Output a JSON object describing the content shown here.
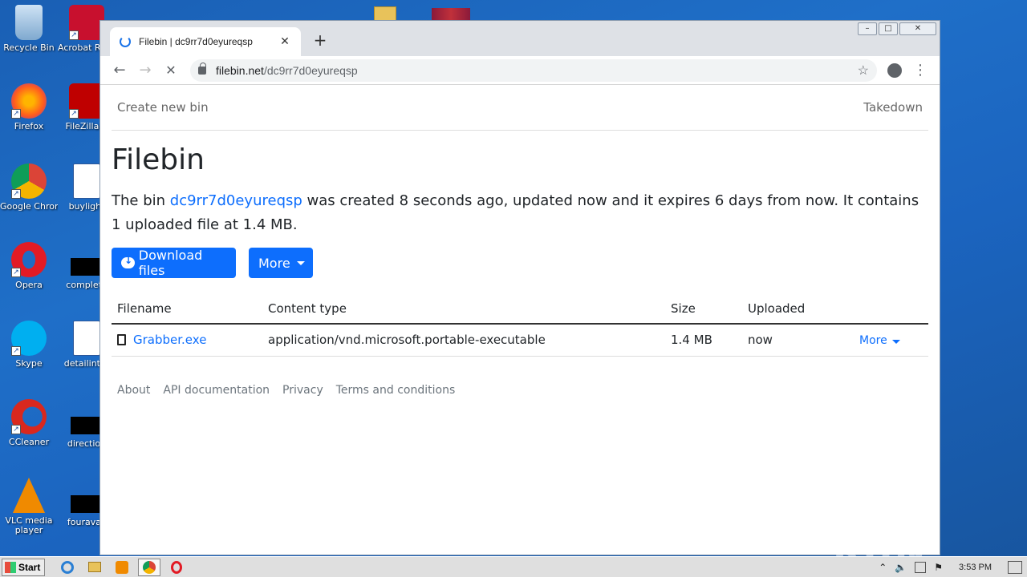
{
  "desktop": {
    "icons": [
      {
        "label": "Recycle Bin",
        "icon": "recycle-bin-icon"
      },
      {
        "label": "Acrobat Reader",
        "icon": "acrobat-icon"
      },
      {
        "label": "Firefox",
        "icon": "firefox-icon"
      },
      {
        "label": "FileZilla C",
        "icon": "filezilla-icon"
      },
      {
        "label": "Google Chrome",
        "icon": "chrome-icon"
      },
      {
        "label": "buylight",
        "icon": "word-doc-icon"
      },
      {
        "label": "Opera",
        "icon": "opera-icon"
      },
      {
        "label": "complete",
        "icon": "file-icon"
      },
      {
        "label": "Skype",
        "icon": "skype-icon"
      },
      {
        "label": "detailinter",
        "icon": "word-doc-icon"
      },
      {
        "label": "CCleaner",
        "icon": "ccleaner-icon"
      },
      {
        "label": "direction",
        "icon": "file-icon"
      },
      {
        "label": "VLC media player",
        "icon": "vlc-icon"
      },
      {
        "label": "fouravail",
        "icon": "file-icon"
      }
    ]
  },
  "browser": {
    "tab_title": "Filebin | dc9rr7d0eyureqsp",
    "url_host": "filebin.net",
    "url_path": "/dc9rr7d0eyureqsp"
  },
  "page": {
    "nav_left": "Create new bin",
    "nav_right": "Takedown",
    "heading": "Filebin",
    "desc_prefix": "The bin ",
    "bin_id": "dc9rr7d0eyureqsp",
    "desc_suffix": " was created 8 seconds ago, updated now and it expires 6 days from now. It contains 1 uploaded file at 1.4 MB.",
    "download_button": "Download files",
    "more_button": "More",
    "table": {
      "headers": [
        "Filename",
        "Content type",
        "Size",
        "Uploaded"
      ],
      "rows": [
        {
          "filename": "Grabber.exe",
          "content_type": "application/vnd.microsoft.portable-executable",
          "size": "1.4 MB",
          "uploaded": "now",
          "action": "More"
        }
      ]
    },
    "footer_links": [
      "About",
      "API documentation",
      "Privacy",
      "Terms and conditions"
    ]
  },
  "watermark": "ANY RUN",
  "taskbar": {
    "start_label": "Start",
    "clock": "3:53 PM"
  }
}
